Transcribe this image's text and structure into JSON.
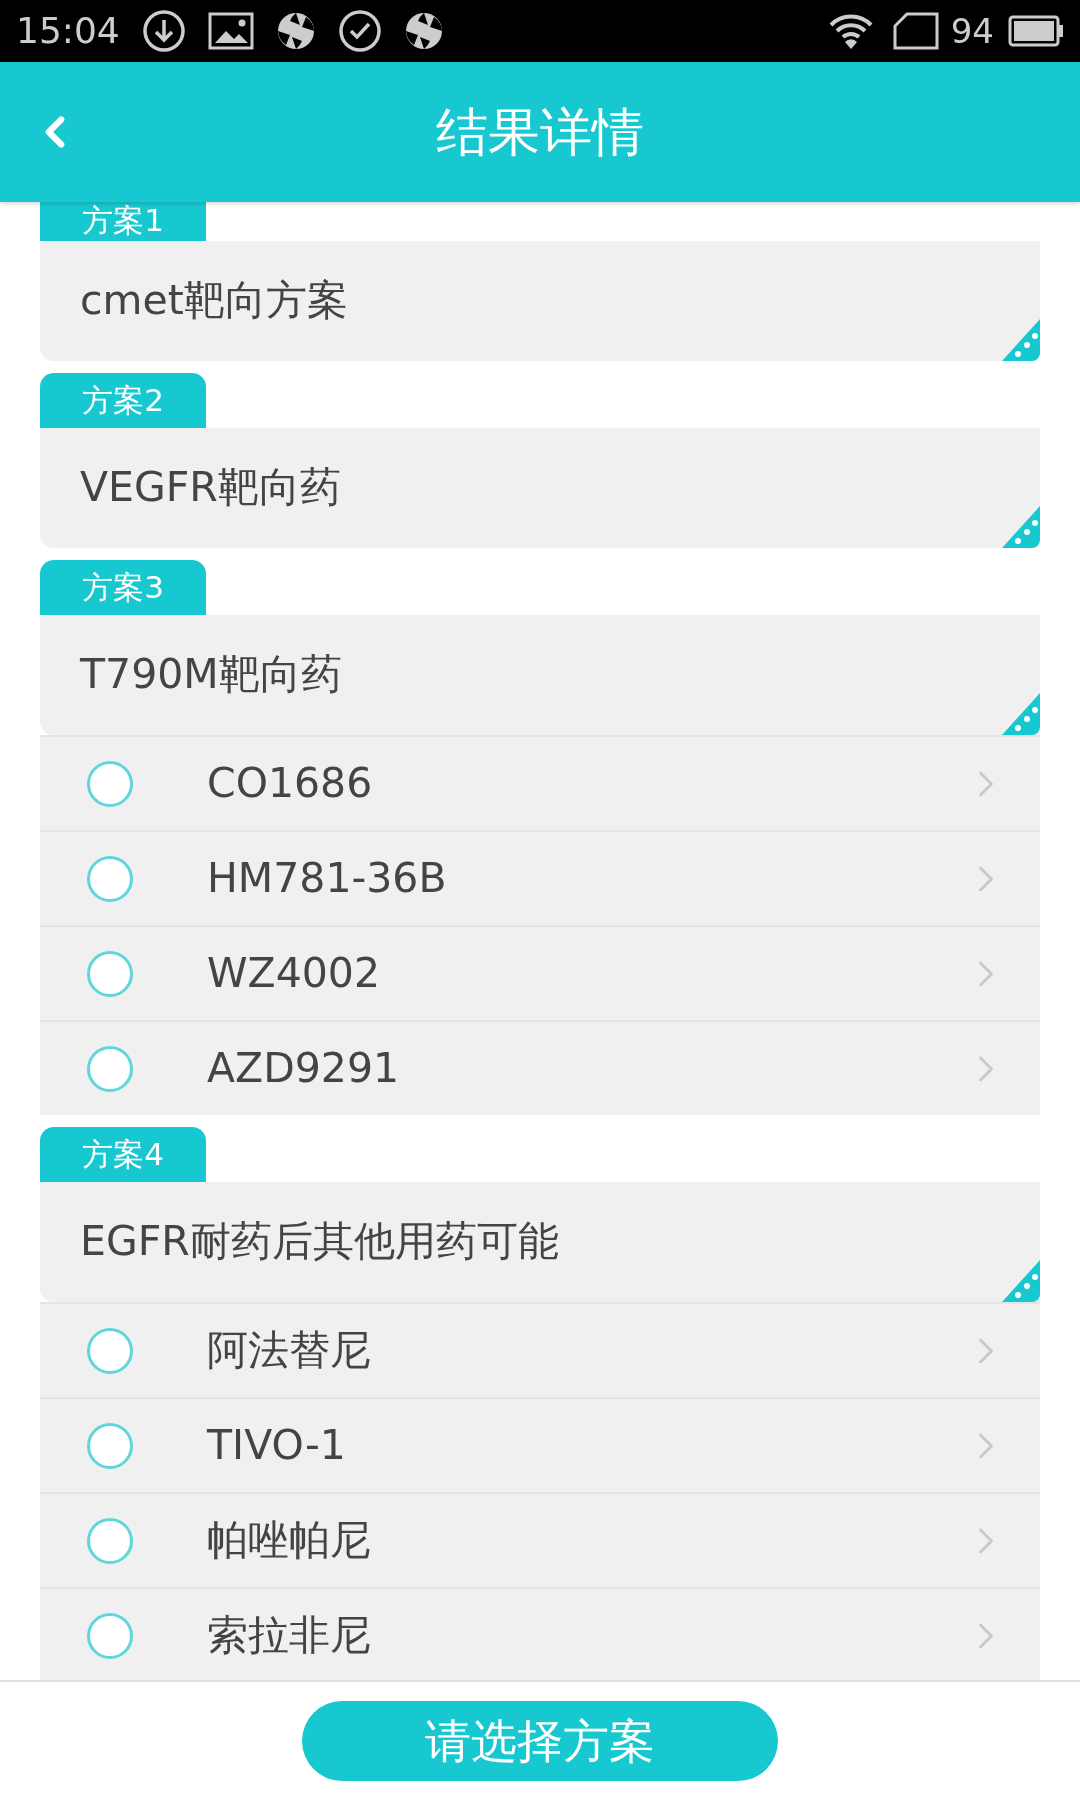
{
  "status_bar": {
    "time": "15:04",
    "battery": "94"
  },
  "header": {
    "title": "结果详情"
  },
  "plans": [
    {
      "label": "方案1",
      "name": "cmet靶向方案"
    },
    {
      "label": "方案2",
      "name": "VEGFR靶向药"
    },
    {
      "label": "方案3",
      "name": "T790M靶向药",
      "options": [
        {
          "name": "CO1686",
          "selected": false
        },
        {
          "name": "HM781-36B",
          "selected": false
        },
        {
          "name": "WZ4002",
          "selected": false
        },
        {
          "name": "AZD9291",
          "selected": false
        }
      ]
    },
    {
      "label": "方案4",
      "name": "EGFR耐药后其他用药可能",
      "options": [
        {
          "name": "阿法替尼",
          "selected": false
        },
        {
          "name": "TIVO-1",
          "selected": false
        },
        {
          "name": "帕唑帕尼",
          "selected": false
        },
        {
          "name": "索拉非尼",
          "selected": false
        }
      ]
    }
  ],
  "submit_button": "请选择方案"
}
